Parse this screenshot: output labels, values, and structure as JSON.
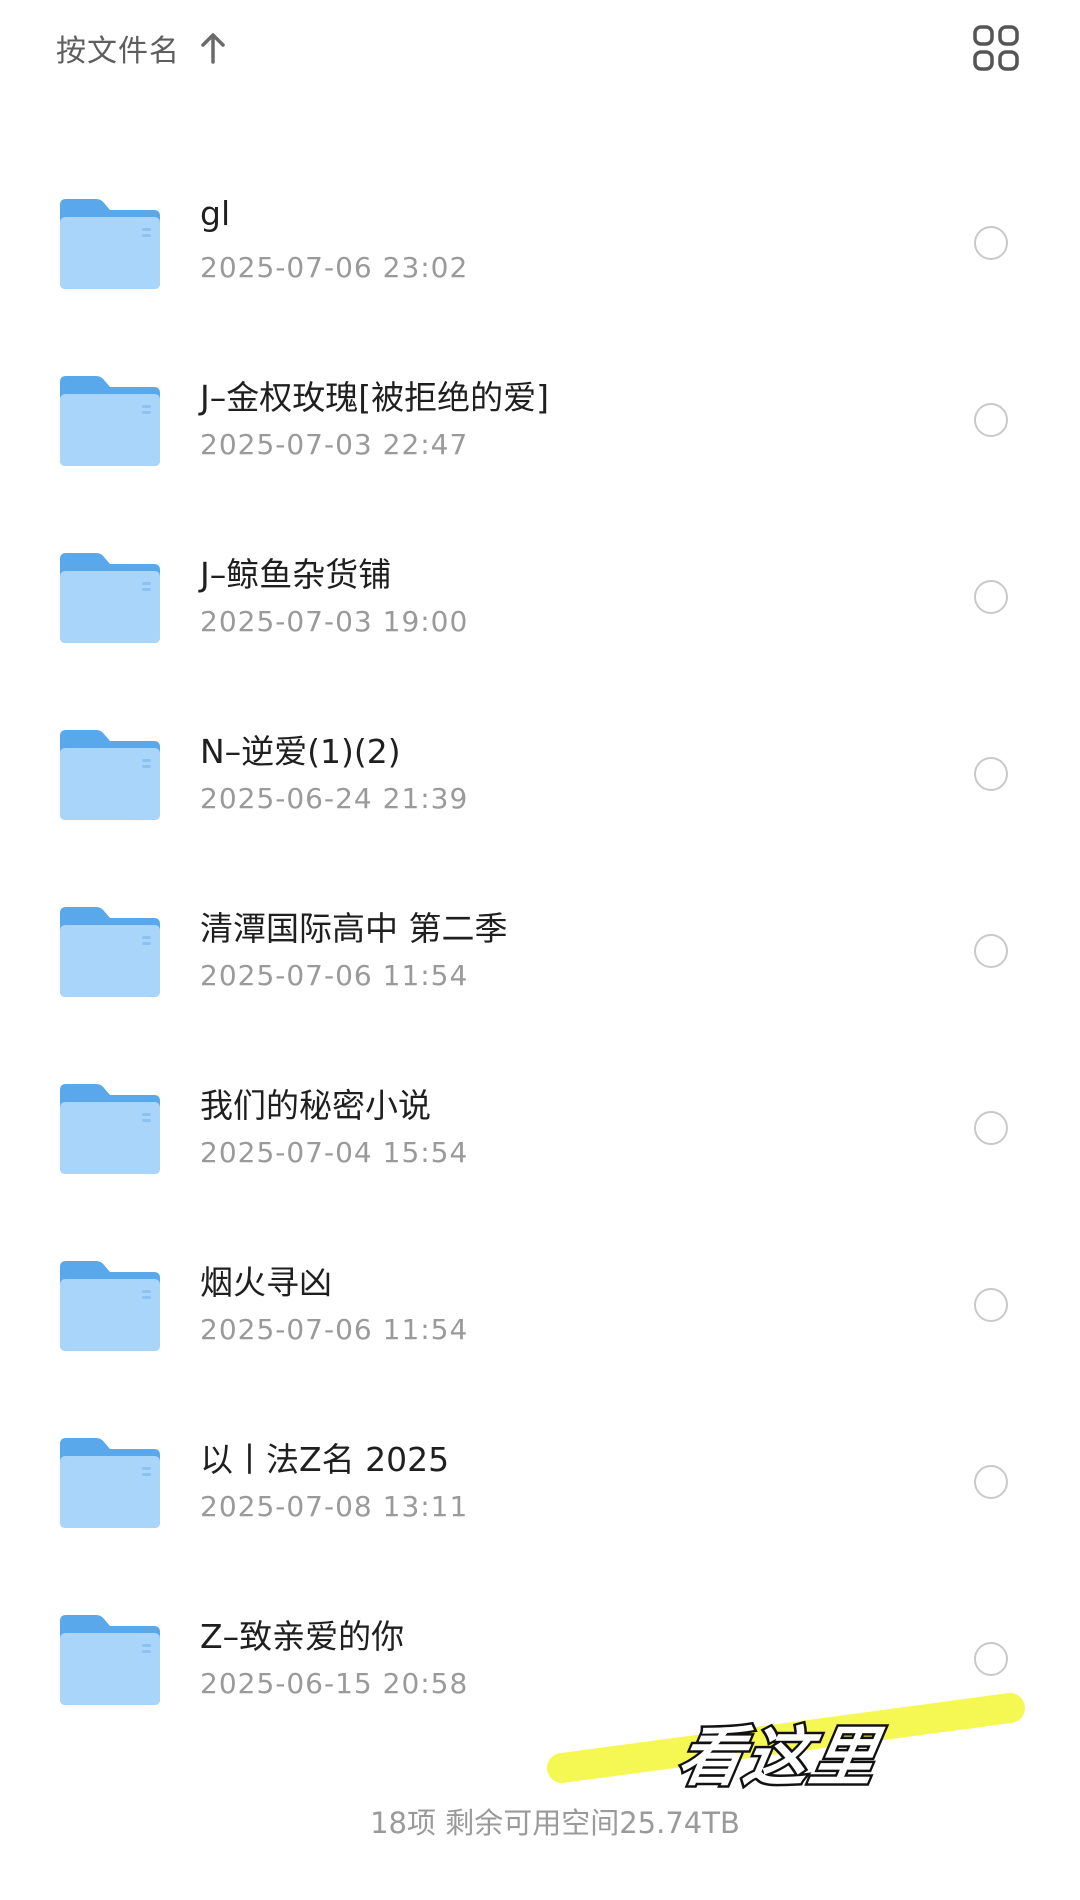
{
  "header": {
    "sort_label": "按文件名",
    "sort_direction_icon": "arrow-up-icon",
    "view_toggle_icon": "grid-view-icon"
  },
  "colors": {
    "folder_back": "#5aa8ec",
    "folder_front": "#a9d5fb",
    "text_primary": "#1f1f1f",
    "text_secondary": "#9a9a9a",
    "highlighter": "#f4f74a"
  },
  "files": [
    {
      "name": "gl",
      "date": "2025-07-06 23:02"
    },
    {
      "name": "J–金权玫瑰[被拒绝的爱]",
      "date": "2025-07-03 22:47"
    },
    {
      "name": "J–鲸鱼杂货铺",
      "date": "2025-07-03 19:00"
    },
    {
      "name": "N–逆爱(1)(2)",
      "date": "2025-06-24 21:39"
    },
    {
      "name": "清潭国际高中 第二季",
      "date": "2025-07-06 11:54"
    },
    {
      "name": "我们的秘密小说",
      "date": "2025-07-04 15:54"
    },
    {
      "name": "烟火寻凶",
      "date": "2025-07-06 11:54"
    },
    {
      "name": "以丨法Z名 2025",
      "date": "2025-07-08 13:11"
    },
    {
      "name": "Z–致亲爱的你",
      "date": "2025-06-15 20:58"
    }
  ],
  "footer": {
    "summary": "18项 剩余可用空间25.74TB"
  },
  "annotation": {
    "text": "看这里"
  }
}
